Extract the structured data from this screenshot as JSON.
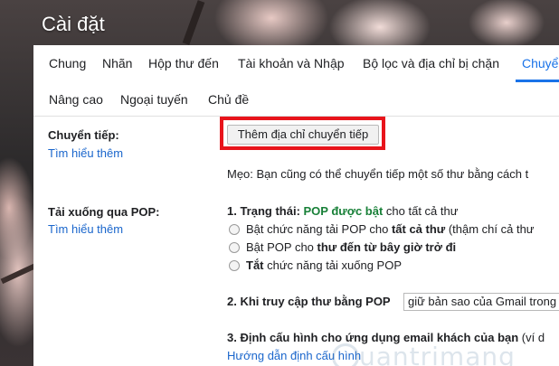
{
  "header": {
    "title": "Cài đặt"
  },
  "tabs": [
    {
      "label": "Chung"
    },
    {
      "label": "Nhãn"
    },
    {
      "label": "Hộp thư đến"
    },
    {
      "label": "Tài khoản và Nhập"
    },
    {
      "label": "Bộ lọc và địa chỉ bị chặn"
    },
    {
      "label": "Chuyể"
    }
  ],
  "tabs2": [
    {
      "label": "Nâng cao"
    },
    {
      "label": "Ngoại tuyến"
    },
    {
      "label": "Chủ đề"
    }
  ],
  "forwarding": {
    "label": "Chuyển tiếp:",
    "learn_more": "Tìm hiểu thêm",
    "add_button": "Thêm địa chỉ chuyển tiếp",
    "tip": "Mẹo: Bạn cũng có thể chuyển tiếp một số thư bằng cách t"
  },
  "pop": {
    "label": "Tải xuống qua POP:",
    "learn_more": "Tìm hiểu thêm",
    "status_prefix": "1. Trạng thái: ",
    "status_value": "POP được bật",
    "status_suffix": " cho tất cả thư",
    "options": [
      {
        "pre": "Bật chức năng tải POP cho ",
        "bold": "tất cả thư",
        "post": " (thậm chí cả thư"
      },
      {
        "pre": "Bật POP cho ",
        "bold": "thư đến từ bây giờ trở đi",
        "post": ""
      },
      {
        "pre": "",
        "bold": "Tắt",
        "post": " chức năng tải xuống POP"
      }
    ],
    "step2_label": "2. Khi truy cập thư bằng POP",
    "step2_select": "giữ bản sao của Gmail trong",
    "step3_label": "3. Định cấu hình cho ứng dụng email khách của bạn",
    "step3_suffix": " (ví d",
    "step3_link": "Hướng dẫn định cấu hình"
  },
  "watermark": "uantrimang"
}
